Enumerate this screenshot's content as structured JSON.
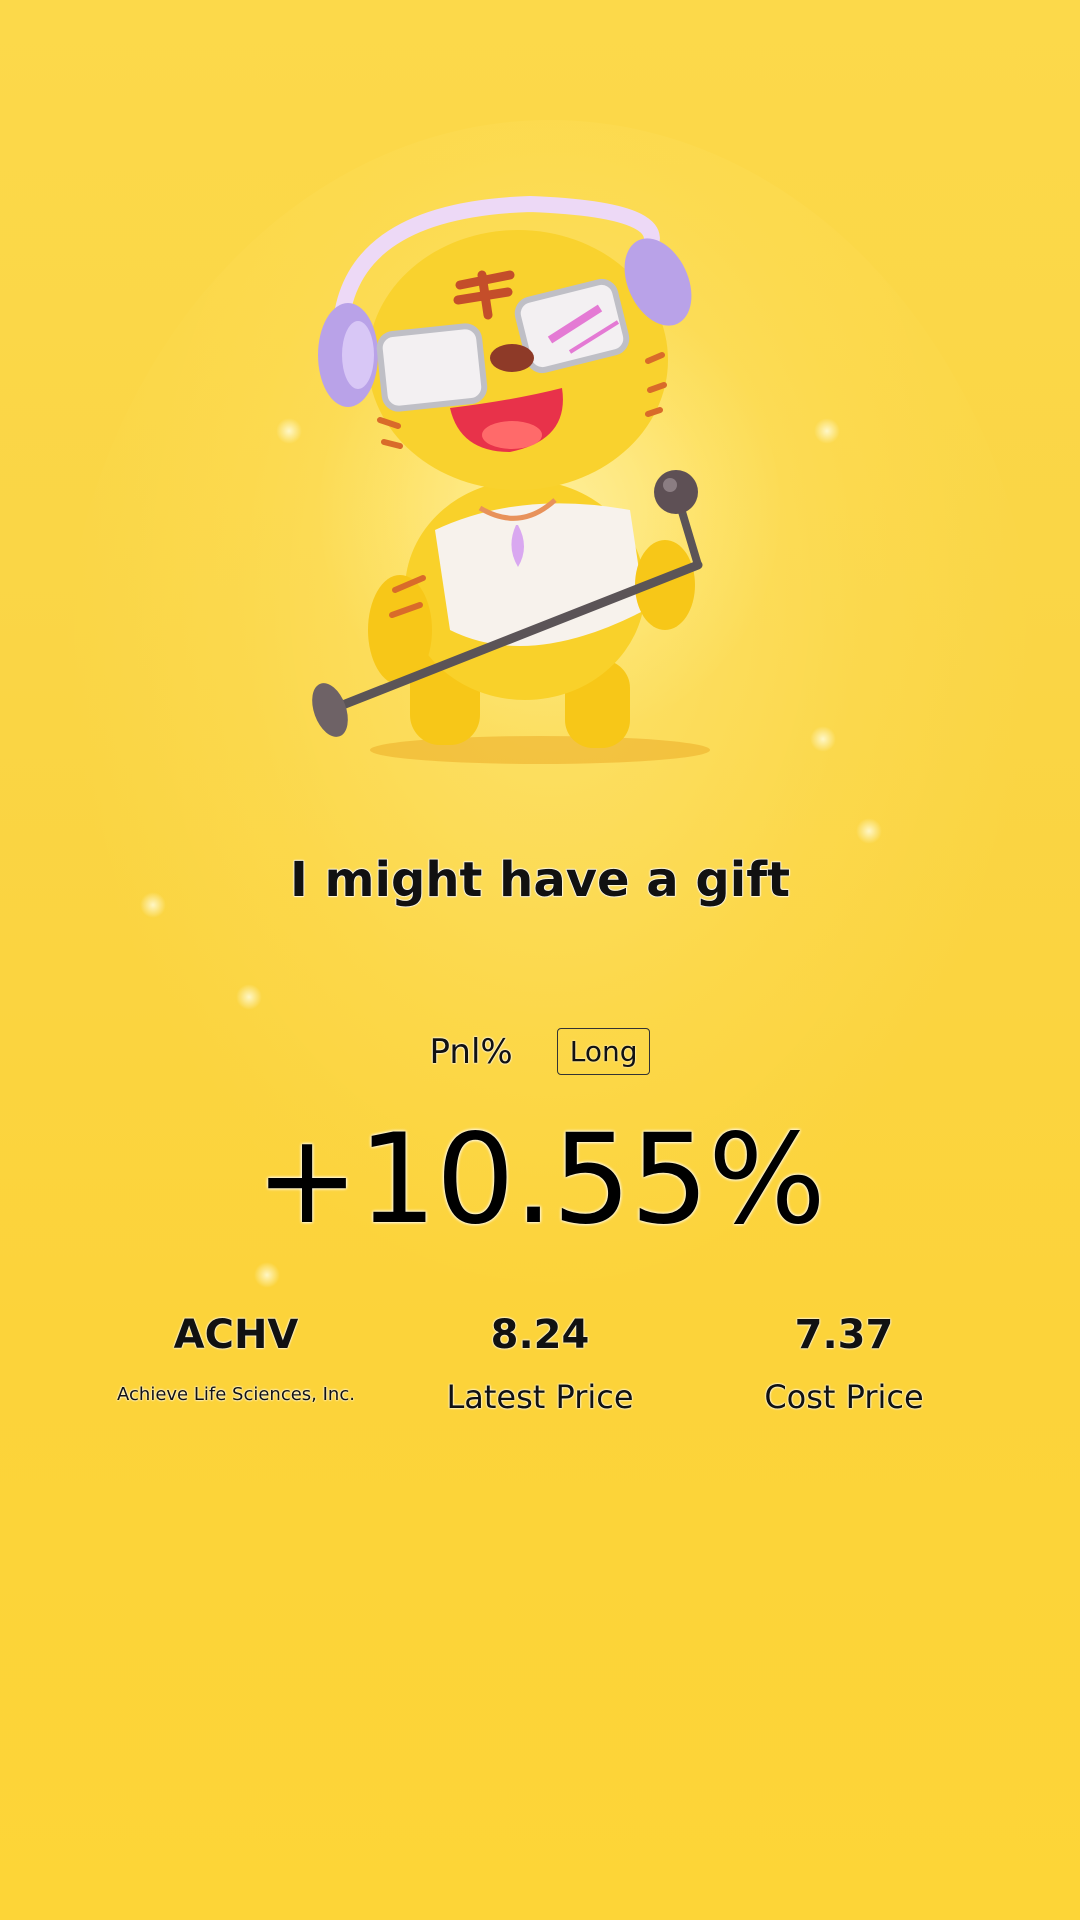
{
  "headline": "I might have a gift",
  "pnl": {
    "label": "Pnl%",
    "position_tag": "Long",
    "value": "+10.55%"
  },
  "stats": {
    "ticker": "ACHV",
    "company": "Achieve Life Sciences, Inc.",
    "latest_price": "8.24",
    "latest_price_label": "Latest Price",
    "cost_price": "7.37",
    "cost_price_label": "Cost Price"
  },
  "colors": {
    "background": "#FCD94A",
    "text": "#111111"
  },
  "icons": {
    "mascot": "tiger-mascot-with-headphones-and-microphone"
  }
}
